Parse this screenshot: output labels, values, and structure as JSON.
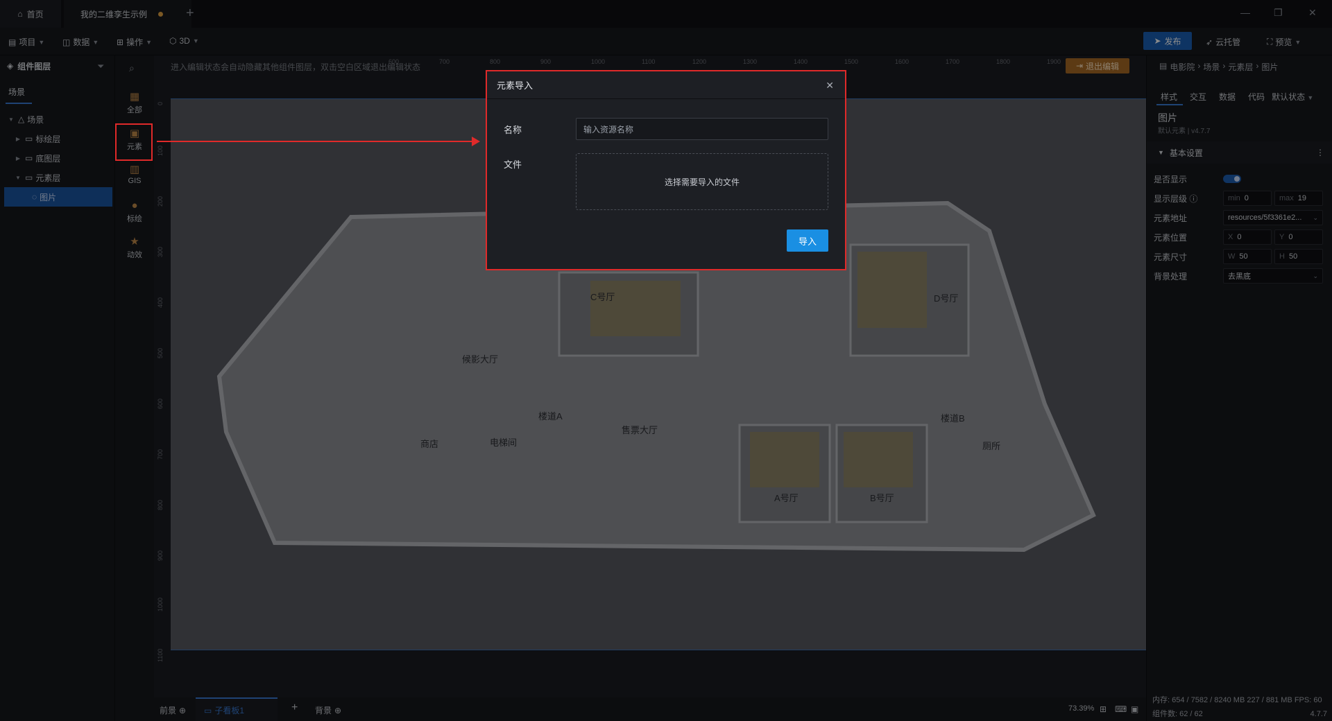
{
  "tabs": {
    "home": "首页",
    "active": "我的二维孪生示例"
  },
  "toolbar": {
    "project": "项目",
    "data": "数据",
    "operate": "操作",
    "three_d": "3D",
    "publish": "发布",
    "cloud": "云托管",
    "preview": "预览"
  },
  "left": {
    "header": "组件图层",
    "tab": "场景",
    "tree": [
      {
        "label": "场景",
        "expanded": true
      },
      {
        "label": "标绘层"
      },
      {
        "label": "底图层"
      },
      {
        "label": "元素层",
        "expanded": true
      },
      {
        "label": "图片",
        "selected": true
      }
    ]
  },
  "rail": {
    "all": "全部",
    "element": "元素",
    "gis": "GIS",
    "mark": "标绘",
    "effect": "动效"
  },
  "canvas": {
    "hint": "进入编辑状态会自动隐藏其他组件图层，双击空白区域退出编辑状态",
    "exit_edit": "退出编辑",
    "ruler_top": [
      "600",
      "700",
      "800",
      "900",
      "1000",
      "1100",
      "1200",
      "1300",
      "1400",
      "1500",
      "1600",
      "1700",
      "1800",
      "1900"
    ],
    "ruler_left": [
      "0",
      "100",
      "200",
      "300",
      "400",
      "500",
      "600",
      "700",
      "800",
      "900",
      "1000",
      "1100"
    ],
    "rooms": [
      "C号厅",
      "D号厅",
      "候影大厅",
      "楼道A",
      "售票大厅",
      "楼道B",
      "商店",
      "电梯间",
      "厕所",
      "A号厅",
      "B号厅"
    ]
  },
  "bottom": {
    "front": "前景",
    "sub_board": "子看板1",
    "background": "背景",
    "zoom": "73.39%"
  },
  "right": {
    "breadcrumb": [
      "电影院",
      "场景",
      "元素层",
      "图片"
    ],
    "tabs": [
      "样式",
      "交互",
      "数据",
      "代码"
    ],
    "state": "默认状态",
    "title": "图片",
    "subtitle": "默认元素 | v4.7.7",
    "section": "基本设置",
    "props": {
      "visible_label": "是否显示",
      "level_label": "显示层级",
      "level_min_pre": "min",
      "level_min": "0",
      "level_max_pre": "max",
      "level_max": "19",
      "url_label": "元素地址",
      "url": "resources/5f3361e2...",
      "pos_label": "元素位置",
      "x_pre": "X",
      "x": "0",
      "y_pre": "Y",
      "y": "0",
      "size_label": "元素尺寸",
      "w_pre": "W",
      "w": "50",
      "h_pre": "H",
      "h": "50",
      "bg_label": "背景处理",
      "bg": "去黑底"
    },
    "footer": {
      "mem": "内存:  654 / 7582 / 8240 MB  227 / 881 MB  FPS:  60",
      "count": "组件数: 62 / 62",
      "version": "4.7.7"
    }
  },
  "modal": {
    "title": "元素导入",
    "name_label": "名称",
    "name_placeholder": "输入资源名称",
    "file_label": "文件",
    "file_hint": "选择需要导入的文件",
    "import_btn": "导入"
  },
  "colors": {
    "accent": "#1a8fe3",
    "highlight": "#e02a2a",
    "publish": "#1a5fb4"
  }
}
